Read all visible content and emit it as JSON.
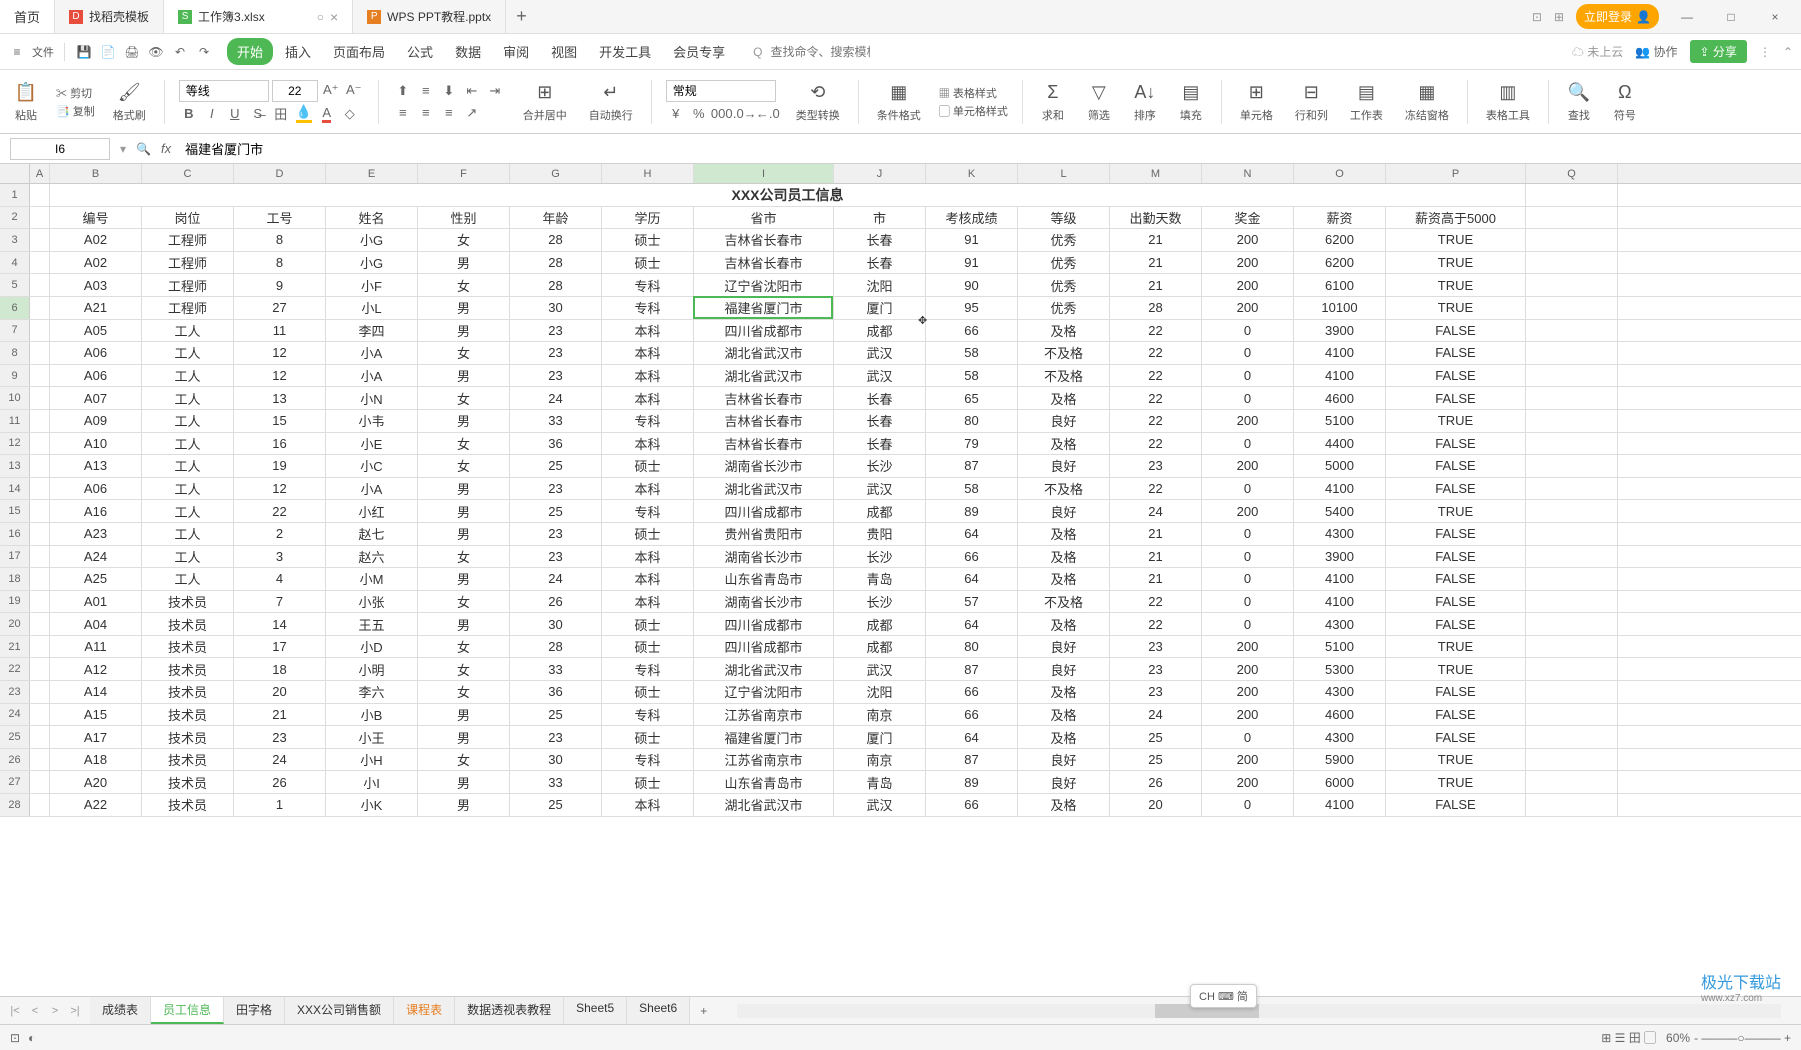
{
  "titlebar": {
    "tabs": [
      {
        "label": "首页",
        "icon": "home",
        "color": "#333"
      },
      {
        "label": "找稻壳模板",
        "icon": "d",
        "color": "#e74c3c"
      },
      {
        "label": "工作簿3.xlsx",
        "icon": "s",
        "color": "#4eb855",
        "active": true
      },
      {
        "label": "WPS PPT教程.pptx",
        "icon": "p",
        "color": "#e67e22"
      }
    ],
    "login": "立即登录"
  },
  "menubar": {
    "file": "文件",
    "tabs": [
      "开始",
      "插入",
      "页面布局",
      "公式",
      "数据",
      "审阅",
      "视图",
      "开发工具",
      "会员专享"
    ],
    "active": 0,
    "search_placeholder": "查找命令、搜索模板",
    "search_icon_label": "Q",
    "cloud": "未上云",
    "coop": "协作",
    "share": "分享"
  },
  "ribbon": {
    "paste": "粘贴",
    "cut": "剪切",
    "copy": "复制",
    "format_painter": "格式刷",
    "font_name": "等线",
    "font_size": "22",
    "merge": "合并居中",
    "wrap": "自动换行",
    "num_format": "常规",
    "type_convert": "类型转换",
    "cond_fmt": "条件格式",
    "table_style": "表格样式",
    "cell_style": "单元格样式",
    "sum": "求和",
    "filter": "筛选",
    "sort": "排序",
    "fill": "填充",
    "cells": "单元格",
    "rowcol": "行和列",
    "sheet": "工作表",
    "freeze": "冻结窗格",
    "table_tools": "表格工具",
    "find": "查找",
    "symbol": "符号"
  },
  "formulabar": {
    "namebox": "I6",
    "formula": "福建省厦门市"
  },
  "columns": [
    "B",
    "C",
    "D",
    "E",
    "F",
    "G",
    "H",
    "I",
    "J",
    "K",
    "L",
    "M",
    "N",
    "O",
    "P",
    "Q"
  ],
  "active_col": "I",
  "active_row": 6,
  "title": "XXX公司员工信息",
  "headers": [
    "编号",
    "岗位",
    "工号",
    "姓名",
    "性别",
    "年龄",
    "学历",
    "省市",
    "市",
    "考核成绩",
    "等级",
    "出勤天数",
    "奖金",
    "薪资",
    "薪资高于5000"
  ],
  "rows": [
    [
      "A02",
      "工程师",
      "8",
      "小G",
      "女",
      "28",
      "硕士",
      "吉林省长春市",
      "长春",
      "91",
      "优秀",
      "21",
      "200",
      "6200",
      "TRUE"
    ],
    [
      "A02",
      "工程师",
      "8",
      "小G",
      "男",
      "28",
      "硕士",
      "吉林省长春市",
      "长春",
      "91",
      "优秀",
      "21",
      "200",
      "6200",
      "TRUE"
    ],
    [
      "A03",
      "工程师",
      "9",
      "小F",
      "女",
      "28",
      "专科",
      "辽宁省沈阳市",
      "沈阳",
      "90",
      "优秀",
      "21",
      "200",
      "6100",
      "TRUE"
    ],
    [
      "A21",
      "工程师",
      "27",
      "小L",
      "男",
      "30",
      "专科",
      "福建省厦门市",
      "厦门",
      "95",
      "优秀",
      "28",
      "200",
      "10100",
      "TRUE"
    ],
    [
      "A05",
      "工人",
      "11",
      "李四",
      "男",
      "23",
      "本科",
      "四川省成都市",
      "成都",
      "66",
      "及格",
      "22",
      "0",
      "3900",
      "FALSE"
    ],
    [
      "A06",
      "工人",
      "12",
      "小A",
      "女",
      "23",
      "本科",
      "湖北省武汉市",
      "武汉",
      "58",
      "不及格",
      "22",
      "0",
      "4100",
      "FALSE"
    ],
    [
      "A06",
      "工人",
      "12",
      "小A",
      "男",
      "23",
      "本科",
      "湖北省武汉市",
      "武汉",
      "58",
      "不及格",
      "22",
      "0",
      "4100",
      "FALSE"
    ],
    [
      "A07",
      "工人",
      "13",
      "小N",
      "女",
      "24",
      "本科",
      "吉林省长春市",
      "长春",
      "65",
      "及格",
      "22",
      "0",
      "4600",
      "FALSE"
    ],
    [
      "A09",
      "工人",
      "15",
      "小韦",
      "男",
      "33",
      "专科",
      "吉林省长春市",
      "长春",
      "80",
      "良好",
      "22",
      "200",
      "5100",
      "TRUE"
    ],
    [
      "A10",
      "工人",
      "16",
      "小E",
      "女",
      "36",
      "本科",
      "吉林省长春市",
      "长春",
      "79",
      "及格",
      "22",
      "0",
      "4400",
      "FALSE"
    ],
    [
      "A13",
      "工人",
      "19",
      "小C",
      "女",
      "25",
      "硕士",
      "湖南省长沙市",
      "长沙",
      "87",
      "良好",
      "23",
      "200",
      "5000",
      "FALSE"
    ],
    [
      "A06",
      "工人",
      "12",
      "小A",
      "男",
      "23",
      "本科",
      "湖北省武汉市",
      "武汉",
      "58",
      "不及格",
      "22",
      "0",
      "4100",
      "FALSE"
    ],
    [
      "A16",
      "工人",
      "22",
      "小红",
      "男",
      "25",
      "专科",
      "四川省成都市",
      "成都",
      "89",
      "良好",
      "24",
      "200",
      "5400",
      "TRUE"
    ],
    [
      "A23",
      "工人",
      "2",
      "赵七",
      "男",
      "23",
      "硕士",
      "贵州省贵阳市",
      "贵阳",
      "64",
      "及格",
      "21",
      "0",
      "4300",
      "FALSE"
    ],
    [
      "A24",
      "工人",
      "3",
      "赵六",
      "女",
      "23",
      "本科",
      "湖南省长沙市",
      "长沙",
      "66",
      "及格",
      "21",
      "0",
      "3900",
      "FALSE"
    ],
    [
      "A25",
      "工人",
      "4",
      "小M",
      "男",
      "24",
      "本科",
      "山东省青岛市",
      "青岛",
      "64",
      "及格",
      "21",
      "0",
      "4100",
      "FALSE"
    ],
    [
      "A01",
      "技术员",
      "7",
      "小张",
      "女",
      "26",
      "本科",
      "湖南省长沙市",
      "长沙",
      "57",
      "不及格",
      "22",
      "0",
      "4100",
      "FALSE"
    ],
    [
      "A04",
      "技术员",
      "14",
      "王五",
      "男",
      "30",
      "硕士",
      "四川省成都市",
      "成都",
      "64",
      "及格",
      "22",
      "0",
      "4300",
      "FALSE"
    ],
    [
      "A11",
      "技术员",
      "17",
      "小D",
      "女",
      "28",
      "硕士",
      "四川省成都市",
      "成都",
      "80",
      "良好",
      "23",
      "200",
      "5100",
      "TRUE"
    ],
    [
      "A12",
      "技术员",
      "18",
      "小明",
      "女",
      "33",
      "专科",
      "湖北省武汉市",
      "武汉",
      "87",
      "良好",
      "23",
      "200",
      "5300",
      "TRUE"
    ],
    [
      "A14",
      "技术员",
      "20",
      "李六",
      "女",
      "36",
      "硕士",
      "辽宁省沈阳市",
      "沈阳",
      "66",
      "及格",
      "23",
      "200",
      "4300",
      "FALSE"
    ],
    [
      "A15",
      "技术员",
      "21",
      "小B",
      "男",
      "25",
      "专科",
      "江苏省南京市",
      "南京",
      "66",
      "及格",
      "24",
      "200",
      "4600",
      "FALSE"
    ],
    [
      "A17",
      "技术员",
      "23",
      "小王",
      "男",
      "23",
      "硕士",
      "福建省厦门市",
      "厦门",
      "64",
      "及格",
      "25",
      "0",
      "4300",
      "FALSE"
    ],
    [
      "A18",
      "技术员",
      "24",
      "小H",
      "女",
      "30",
      "专科",
      "江苏省南京市",
      "南京",
      "87",
      "良好",
      "25",
      "200",
      "5900",
      "TRUE"
    ],
    [
      "A20",
      "技术员",
      "26",
      "小I",
      "男",
      "33",
      "硕士",
      "山东省青岛市",
      "青岛",
      "89",
      "良好",
      "26",
      "200",
      "6000",
      "TRUE"
    ],
    [
      "A22",
      "技术员",
      "1",
      "小K",
      "男",
      "25",
      "本科",
      "湖北省武汉市",
      "武汉",
      "66",
      "及格",
      "20",
      "0",
      "4100",
      "FALSE"
    ]
  ],
  "chart_data": {
    "type": "table",
    "title": "XXX公司员工信息",
    "columns": [
      "编号",
      "岗位",
      "工号",
      "姓名",
      "性别",
      "年龄",
      "学历",
      "省市",
      "市",
      "考核成绩",
      "等级",
      "出勤天数",
      "奖金",
      "薪资",
      "薪资高于5000"
    ],
    "data": [
      [
        "A02",
        "工程师",
        8,
        "小G",
        "女",
        28,
        "硕士",
        "吉林省长春市",
        "长春",
        91,
        "优秀",
        21,
        200,
        6200,
        "TRUE"
      ],
      [
        "A02",
        "工程师",
        8,
        "小G",
        "男",
        28,
        "硕士",
        "吉林省长春市",
        "长春",
        91,
        "优秀",
        21,
        200,
        6200,
        "TRUE"
      ],
      [
        "A03",
        "工程师",
        9,
        "小F",
        "女",
        28,
        "专科",
        "辽宁省沈阳市",
        "沈阳",
        90,
        "优秀",
        21,
        200,
        6100,
        "TRUE"
      ],
      [
        "A21",
        "工程师",
        27,
        "小L",
        "男",
        30,
        "专科",
        "福建省厦门市",
        "厦门",
        95,
        "优秀",
        28,
        200,
        10100,
        "TRUE"
      ],
      [
        "A05",
        "工人",
        11,
        "李四",
        "男",
        23,
        "本科",
        "四川省成都市",
        "成都",
        66,
        "及格",
        22,
        0,
        3900,
        "FALSE"
      ],
      [
        "A06",
        "工人",
        12,
        "小A",
        "女",
        23,
        "本科",
        "湖北省武汉市",
        "武汉",
        58,
        "不及格",
        22,
        0,
        4100,
        "FALSE"
      ],
      [
        "A06",
        "工人",
        12,
        "小A",
        "男",
        23,
        "本科",
        "湖北省武汉市",
        "武汉",
        58,
        "不及格",
        22,
        0,
        4100,
        "FALSE"
      ],
      [
        "A07",
        "工人",
        13,
        "小N",
        "女",
        24,
        "本科",
        "吉林省长春市",
        "长春",
        65,
        "及格",
        22,
        0,
        4600,
        "FALSE"
      ],
      [
        "A09",
        "工人",
        15,
        "小韦",
        "男",
        33,
        "专科",
        "吉林省长春市",
        "长春",
        80,
        "良好",
        22,
        200,
        5100,
        "TRUE"
      ],
      [
        "A10",
        "工人",
        16,
        "小E",
        "女",
        36,
        "本科",
        "吉林省长春市",
        "长春",
        79,
        "及格",
        22,
        0,
        4400,
        "FALSE"
      ],
      [
        "A13",
        "工人",
        19,
        "小C",
        "女",
        25,
        "硕士",
        "湖南省长沙市",
        "长沙",
        87,
        "良好",
        23,
        200,
        5000,
        "FALSE"
      ],
      [
        "A06",
        "工人",
        12,
        "小A",
        "男",
        23,
        "本科",
        "湖北省武汉市",
        "武汉",
        58,
        "不及格",
        22,
        0,
        4100,
        "FALSE"
      ],
      [
        "A16",
        "工人",
        22,
        "小红",
        "男",
        25,
        "专科",
        "四川省成都市",
        "成都",
        89,
        "良好",
        24,
        200,
        5400,
        "TRUE"
      ],
      [
        "A23",
        "工人",
        2,
        "赵七",
        "男",
        23,
        "硕士",
        "贵州省贵阳市",
        "贵阳",
        64,
        "及格",
        21,
        0,
        4300,
        "FALSE"
      ],
      [
        "A24",
        "工人",
        3,
        "赵六",
        "女",
        23,
        "本科",
        "湖南省长沙市",
        "长沙",
        66,
        "及格",
        21,
        0,
        3900,
        "FALSE"
      ],
      [
        "A25",
        "工人",
        4,
        "小M",
        "男",
        24,
        "本科",
        "山东省青岛市",
        "青岛",
        64,
        "及格",
        21,
        0,
        4100,
        "FALSE"
      ],
      [
        "A01",
        "技术员",
        7,
        "小张",
        "女",
        26,
        "本科",
        "湖南省长沙市",
        "长沙",
        57,
        "不及格",
        22,
        0,
        4100,
        "FALSE"
      ],
      [
        "A04",
        "技术员",
        14,
        "王五",
        "男",
        30,
        "硕士",
        "四川省成都市",
        "成都",
        64,
        "及格",
        22,
        0,
        4300,
        "FALSE"
      ],
      [
        "A11",
        "技术员",
        17,
        "小D",
        "女",
        28,
        "硕士",
        "四川省成都市",
        "成都",
        80,
        "良好",
        23,
        200,
        5100,
        "TRUE"
      ],
      [
        "A12",
        "技术员",
        18,
        "小明",
        "女",
        33,
        "专科",
        "湖北省武汉市",
        "武汉",
        87,
        "良好",
        23,
        200,
        5300,
        "TRUE"
      ],
      [
        "A14",
        "技术员",
        20,
        "李六",
        "女",
        36,
        "硕士",
        "辽宁省沈阳市",
        "沈阳",
        66,
        "及格",
        23,
        200,
        4300,
        "FALSE"
      ],
      [
        "A15",
        "技术员",
        21,
        "小B",
        "男",
        25,
        "专科",
        "江苏省南京市",
        "南京",
        66,
        "及格",
        24,
        200,
        4600,
        "FALSE"
      ],
      [
        "A17",
        "技术员",
        23,
        "小王",
        "男",
        23,
        "硕士",
        "福建省厦门市",
        "厦门",
        64,
        "及格",
        25,
        0,
        4300,
        "FALSE"
      ],
      [
        "A18",
        "技术员",
        24,
        "小H",
        "女",
        30,
        "专科",
        "江苏省南京市",
        "南京",
        87,
        "良好",
        25,
        200,
        5900,
        "TRUE"
      ],
      [
        "A20",
        "技术员",
        26,
        "小I",
        "男",
        33,
        "硕士",
        "山东省青岛市",
        "青岛",
        89,
        "良好",
        26,
        200,
        6000,
        "TRUE"
      ],
      [
        "A22",
        "技术员",
        1,
        "小K",
        "男",
        25,
        "本科",
        "湖北省武汉市",
        "武汉",
        66,
        "及格",
        20,
        0,
        4100,
        "FALSE"
      ]
    ]
  },
  "ime": "CH ⌨ 简",
  "sheets": [
    "成绩表",
    "员工信息",
    "田字格",
    "XXX公司销售额",
    "课程表",
    "数据透视表教程",
    "Sheet5",
    "Sheet6"
  ],
  "active_sheet": 1,
  "orange_sheet": 4,
  "statusbar": {
    "zoom": "60%",
    "zoom_sep": " - ———○——— + "
  },
  "watermark": {
    "main": "极光下载站",
    "sub": "www.xz7.com"
  }
}
